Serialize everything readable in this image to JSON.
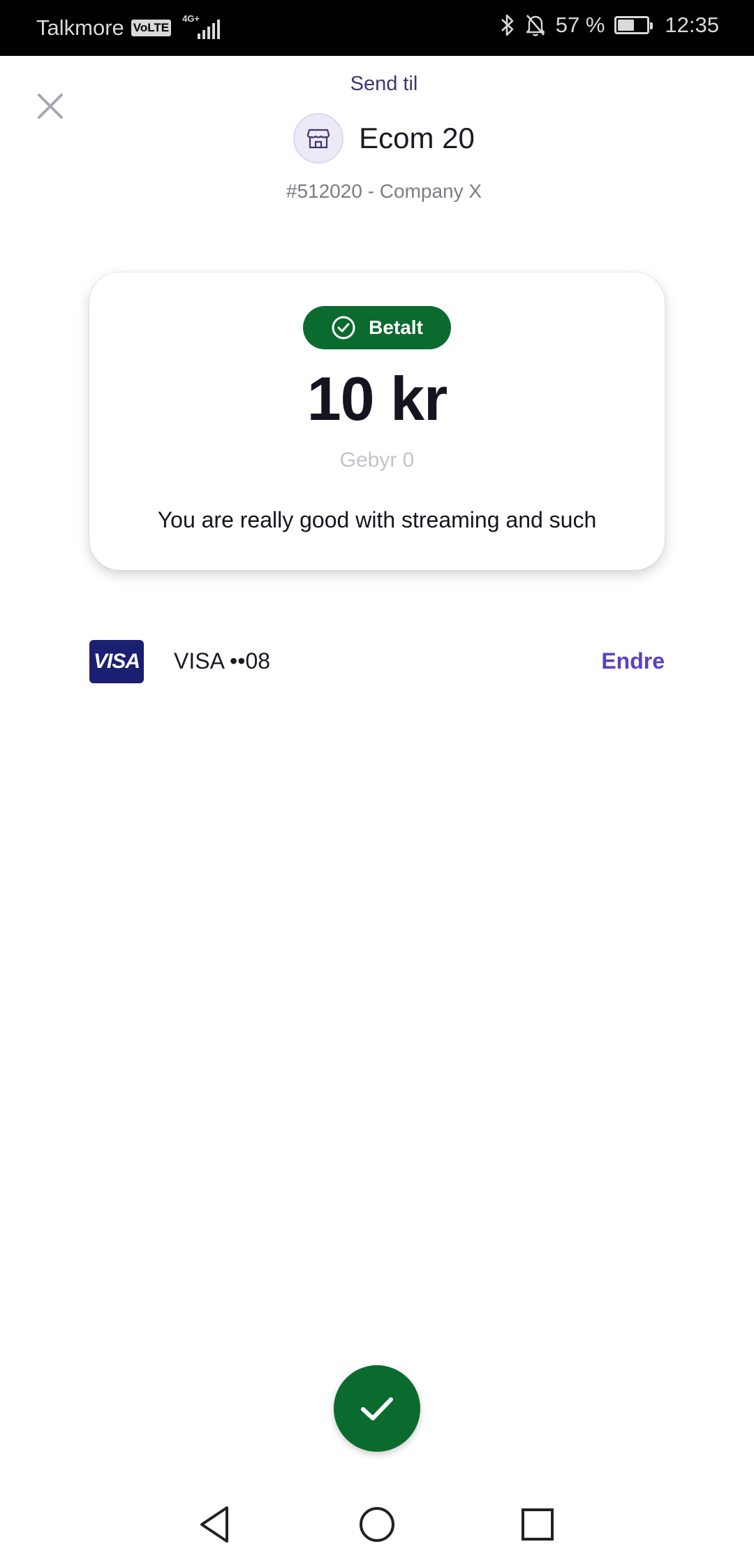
{
  "status_bar": {
    "carrier": "Talkmore",
    "volte": "VoLTE",
    "network": "4G+",
    "battery_text": "57 %",
    "battery_level": 0.57,
    "time": "12:35",
    "icons": [
      "bluetooth-icon",
      "bell-off-icon",
      "battery-icon",
      "signal-icon"
    ]
  },
  "header": {
    "close_icon": "close-icon",
    "send_label": "Send til",
    "recipient_name": "Ecom 20",
    "recipient_icon": "store-icon",
    "recipient_id": "#512020 - Company X"
  },
  "card": {
    "status_label": "Betalt",
    "status_icon": "check-circle-icon",
    "amount": "10 kr",
    "fee": "Gebyr 0",
    "message": "You are really good with streaming and such"
  },
  "payment_method": {
    "logo_text": "VISA",
    "label": "VISA ••08",
    "change_label": "Endre"
  },
  "actions": {
    "confirm_icon": "checkmark-icon"
  },
  "nav": {
    "back_icon": "back-icon",
    "home_icon": "home-icon",
    "recents_icon": "recents-icon"
  },
  "colors": {
    "accent": "#5b3fc4",
    "success": "#0b6b2e",
    "header_text": "#3f3570",
    "visa_blue": "#1b1f72"
  }
}
